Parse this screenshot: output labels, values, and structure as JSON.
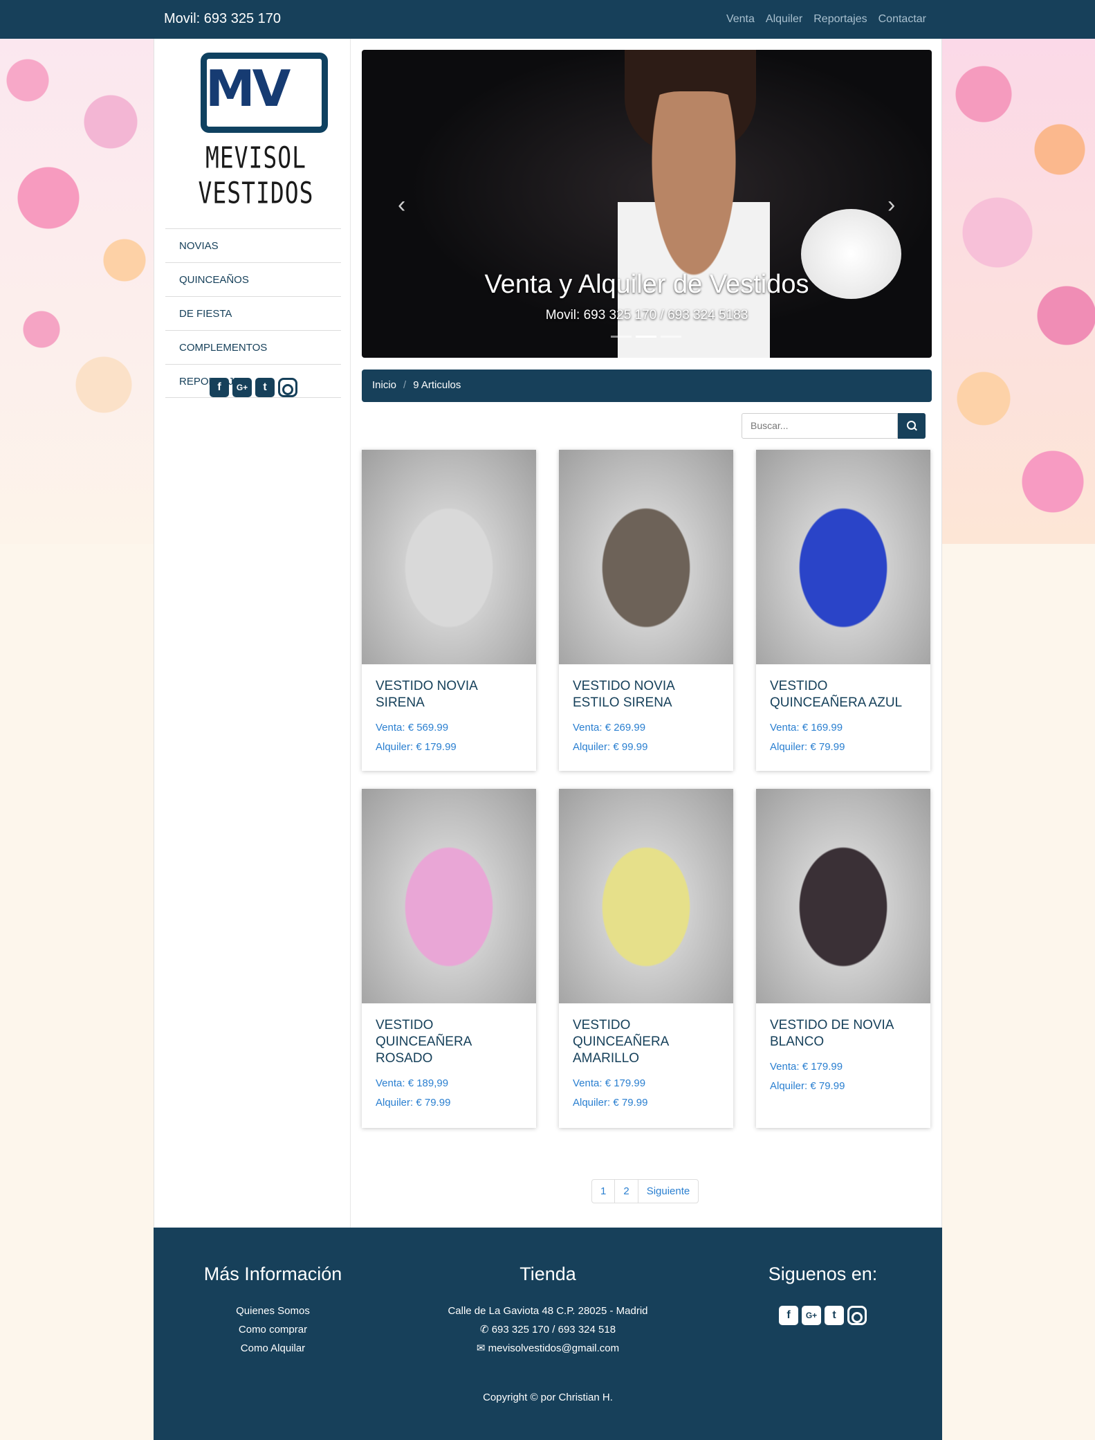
{
  "topbar": {
    "phone": "Movil: 693 325 170",
    "nav": [
      "Venta",
      "Alquiler",
      "Reportajes",
      "Contactar"
    ]
  },
  "logo": {
    "mark": "MV",
    "brand": "MEVISOL VESTIDOS"
  },
  "sidebar": {
    "menu": [
      "NOVIAS",
      "QUINCEAÑOS",
      "DE FIESTA",
      "COMPLEMENTOS",
      "REPORTAJES"
    ],
    "social_icons": [
      "facebook-icon",
      "google-plus-icon",
      "twitter-icon",
      "instagram-icon"
    ]
  },
  "carousel": {
    "title": "Venta y Alquiler de Vestidos",
    "subtitle": "Movil: 693 325 170 / 693 324 5183",
    "prev": "‹",
    "next": "›",
    "active_slide": 2,
    "slide_count": 3
  },
  "breadcrumb": {
    "home": "Inicio",
    "sep": "/",
    "current": "9 Articulos"
  },
  "search": {
    "placeholder": "Buscar..."
  },
  "products": [
    {
      "title": "VESTIDO NOVIA SIRENA",
      "sale": "Venta: € 569.99",
      "rent": "Alquiler: € 179.99",
      "color": "#d9d9d9"
    },
    {
      "title": "VESTIDO NOVIA ESTILO SIRENA",
      "sale": "Venta: € 269.99",
      "rent": "Alquiler: € 99.99",
      "color": "#6d6258"
    },
    {
      "title": "VESTIDO QUINCEAÑERA AZUL",
      "sale": "Venta: € 169.99",
      "rent": "Alquiler: € 79.99",
      "color": "#2a44c8"
    },
    {
      "title": "VESTIDO QUINCEAÑERA ROSADO",
      "sale": "Venta: € 189,99",
      "rent": "Alquiler: € 79.99",
      "color": "#e9a6d6"
    },
    {
      "title": "VESTIDO QUINCEAÑERA AMARILLO",
      "sale": "Venta: € 179.99",
      "rent": "Alquiler: € 79.99",
      "color": "#e6e08a"
    },
    {
      "title": "VESTIDO DE NOVIA BLANCO",
      "sale": "Venta: € 179.99",
      "rent": "Alquiler: € 79.99",
      "color": "#3a3036"
    }
  ],
  "pager": [
    "1",
    "2",
    "Siguiente"
  ],
  "footer": {
    "info_title": "Más Información",
    "info_links": [
      "Quienes Somos",
      "Como comprar",
      "Como Alquilar"
    ],
    "store_title": "Tienda",
    "address": "Calle de La Gaviota 48 C.P. 28025 - Madrid",
    "phones": "693 325 170 / 693 324 518",
    "email": "mevisolvestidos@gmail.com",
    "follow_title": "Siguenos en:",
    "copyright": "Copyright © por Christian H."
  }
}
